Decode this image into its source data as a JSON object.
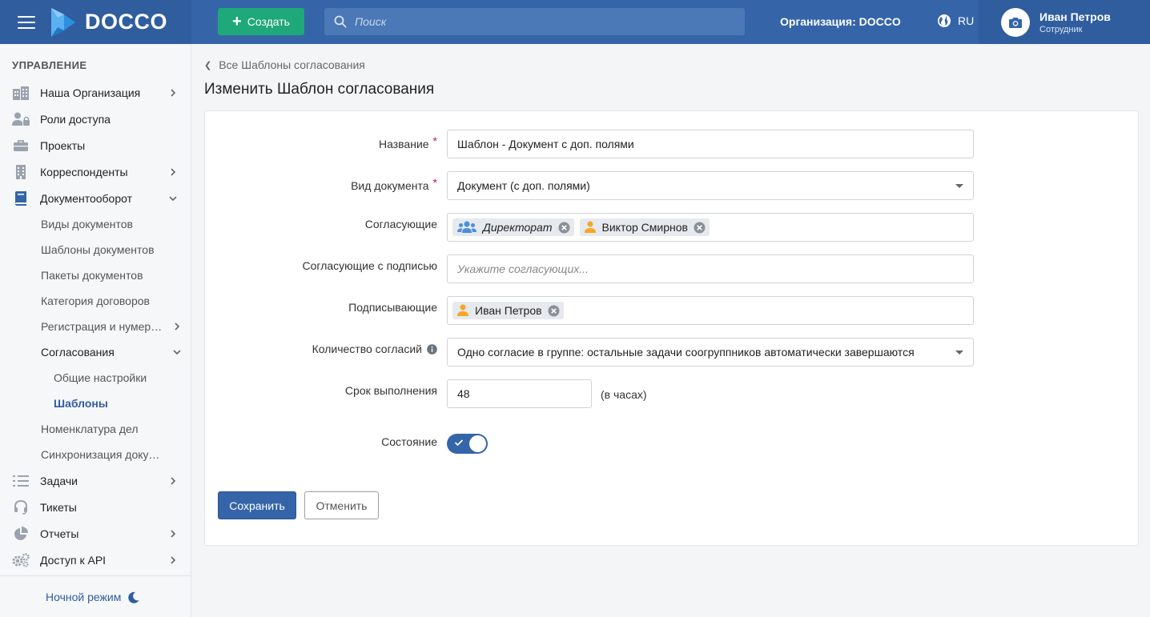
{
  "header": {
    "brand": "DOCCO",
    "create_label": "Создать",
    "search_placeholder": "Поиск",
    "organization": "Организация: DOCCO",
    "language": "RU",
    "user_name": "Иван Петров",
    "user_role": "Сотрудник",
    "icons": [
      "menu-icon",
      "plus-icon",
      "search-icon",
      "globe-icon",
      "camera-icon"
    ]
  },
  "sidebar": {
    "section_title": "УПРАВЛЕНИЕ",
    "items": [
      {
        "label": "Наша Организация",
        "icon": "buildings-icon",
        "expandable": true
      },
      {
        "label": "Роли доступа",
        "icon": "users-lock-icon",
        "expandable": false
      },
      {
        "label": "Проекты",
        "icon": "briefcase-icon",
        "expandable": false
      },
      {
        "label": "Корреспонденты",
        "icon": "building-icon",
        "expandable": true
      },
      {
        "label": "Документооборот",
        "icon": "book-icon",
        "expandable": true,
        "expanded": true
      },
      {
        "label": "Задачи",
        "icon": "tasks-icon",
        "expandable": true
      },
      {
        "label": "Тикеты",
        "icon": "headset-icon",
        "expandable": false
      },
      {
        "label": "Отчеты",
        "icon": "pie-chart-icon",
        "expandable": true
      },
      {
        "label": "Доступ к API",
        "icon": "gears-icon",
        "expandable": true
      }
    ],
    "doc_subitems": [
      {
        "label": "Виды документов"
      },
      {
        "label": "Шаблоны документов"
      },
      {
        "label": "Пакеты документов"
      },
      {
        "label": "Категория договоров"
      },
      {
        "label": "Регистрация и нумерация",
        "expandable": true
      },
      {
        "label": "Согласования",
        "expandable": true,
        "expanded": true
      },
      {
        "label": "Номенклатура дел"
      },
      {
        "label": "Синхронизация документов"
      }
    ],
    "approval_subitems": [
      {
        "label": "Общие настройки",
        "active": false
      },
      {
        "label": "Шаблоны",
        "active": true
      }
    ],
    "night_mode_label": "Ночной режим"
  },
  "main": {
    "breadcrumb": "Все Шаблоны согласования",
    "title": "Изменить Шаблон согласования",
    "form": {
      "name_label": "Название",
      "name_value": "Шаблон - Документ с доп. полями",
      "doc_type_label": "Вид документа",
      "doc_type_value": "Документ (с доп. полями)",
      "approvers_label": "Согласующие",
      "approvers": [
        {
          "label": "Директорат",
          "type": "group",
          "icon": "users-icon"
        },
        {
          "label": "Виктор Смирнов",
          "type": "user",
          "icon": "user-icon"
        }
      ],
      "approvers_sign_label": "Согласующие с подписью",
      "approvers_sign_placeholder": "Укажите согласующих...",
      "signers_label": "Подписывающие",
      "signers": [
        {
          "label": "Иван Петров",
          "type": "user",
          "icon": "user-icon"
        }
      ],
      "count_label": "Количество согласий",
      "count_value": "Одно согласие в группе: остальные задачи соогруппников автоматически завершаются",
      "deadline_label": "Срок выполнения",
      "deadline_value": "48",
      "deadline_unit": "(в часах)",
      "state_label": "Состояние",
      "state_on": true
    },
    "save_label": "Сохранить",
    "cancel_label": "Отменить"
  },
  "colors": {
    "primary": "#3565a8",
    "header_dark": "#2f5d9e",
    "create_green": "#1fa87a",
    "required": "#c2185b",
    "user_icon": "#f5a623",
    "group_icon": "#4a90d9"
  }
}
